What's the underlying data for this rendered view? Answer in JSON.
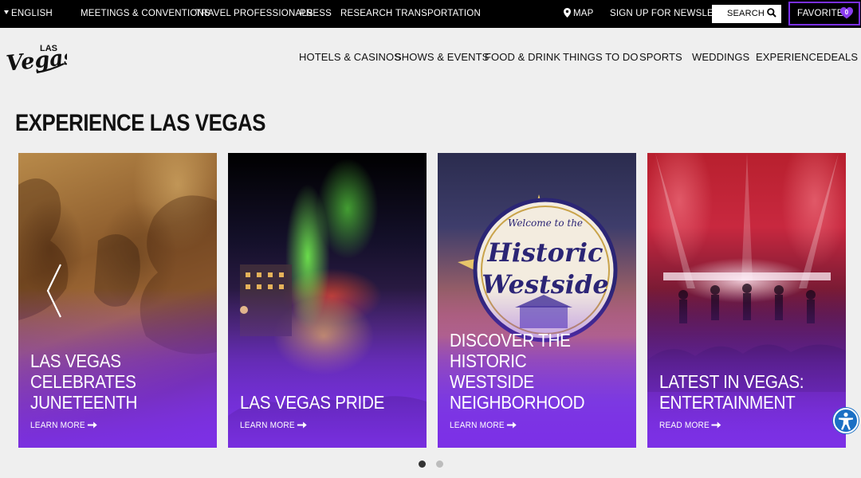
{
  "topbar": {
    "language": "ENGLISH",
    "links": [
      "MEETINGS & CONVENTIONS",
      "TRAVEL PROFESSIONALS",
      "PRESS",
      "RESEARCH",
      "TRANSPORTATION"
    ],
    "map_label": "MAP",
    "newsletter_label": "SIGN UP FOR NEWSLETTER",
    "search_label": "SEARCH",
    "favorites_label": "FAVORITES",
    "favorites_count": "0"
  },
  "logo": {
    "line1": "LAS",
    "line2": "Vegas"
  },
  "nav": {
    "items": [
      "HOTELS & CASINOS",
      "SHOWS & EVENTS",
      "FOOD & DRINK",
      "THINGS TO DO",
      "SPORTS",
      "WEDDINGS",
      "EXPERIENCE",
      "DEALS"
    ]
  },
  "page": {
    "title": "EXPERIENCE LAS VEGAS"
  },
  "cards": [
    {
      "title_line1": "LAS VEGAS CELEBRATES",
      "title_line2": "JUNETEENTH",
      "link": "LEARN MORE"
    },
    {
      "title_line1": "LAS VEGAS PRIDE",
      "link": "LEARN MORE"
    },
    {
      "title_line1": "DISCOVER THE HISTORIC",
      "title_line2": "WESTSIDE",
      "title_line3": "NEIGHBORHOOD",
      "link": "LEARN MORE",
      "sign": {
        "welcome": "Welcome to the",
        "line1": "Historic",
        "line2": "Westside"
      }
    },
    {
      "title_line1": "LATEST IN VEGAS:",
      "title_line2": "ENTERTAINMENT",
      "link": "READ MORE"
    }
  ],
  "carousel": {
    "active_slide": 1,
    "slide_count": 2
  },
  "colors": {
    "accent": "#7b2ff0",
    "topbar_bg": "#000000",
    "page_bg": "#efefef",
    "a11y": "#1a6fc4"
  },
  "icons": [
    "caret-down-icon",
    "map-pin-icon",
    "search-icon",
    "heart-icon",
    "arrow-right-icon",
    "chevron-left-icon",
    "accessibility-icon"
  ]
}
